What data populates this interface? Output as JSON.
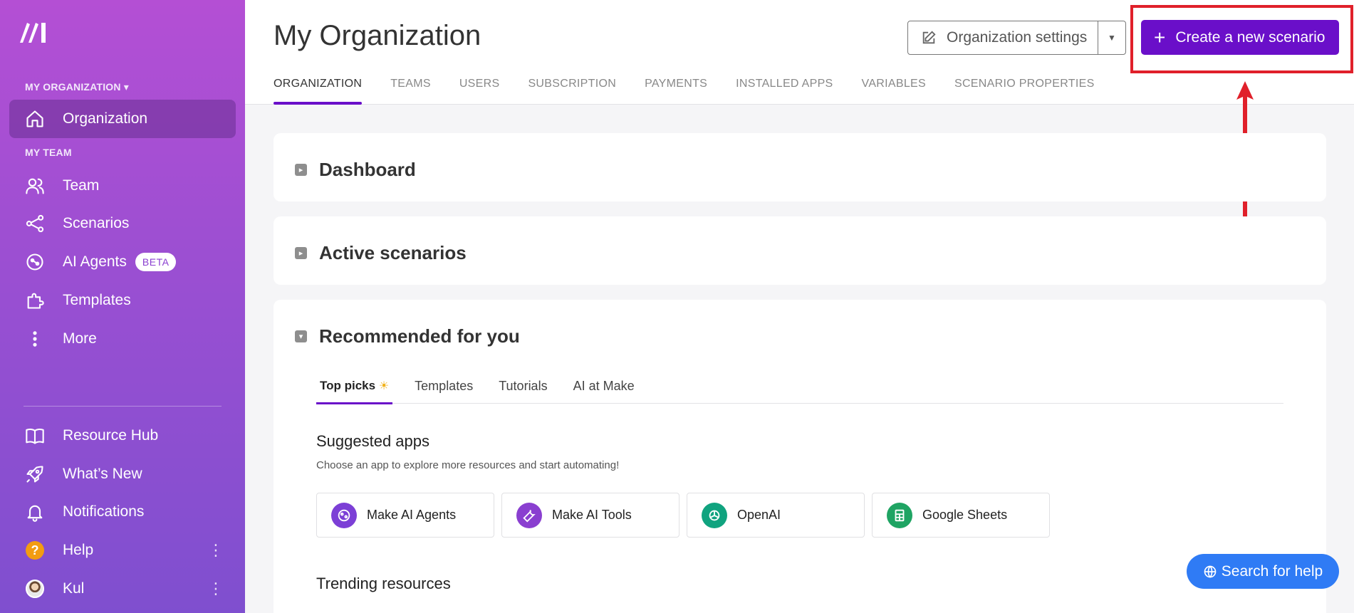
{
  "sidebar": {
    "section_org": "MY ORGANIZATION",
    "section_team": "MY TEAM",
    "items": [
      {
        "label": "Organization"
      },
      {
        "label": "Team"
      },
      {
        "label": "Scenarios"
      },
      {
        "label": "AI Agents",
        "badge": "BETA"
      },
      {
        "label": "Templates"
      },
      {
        "label": "More"
      }
    ],
    "bottom_items": [
      {
        "label": "Resource Hub"
      },
      {
        "label": "What’s New"
      },
      {
        "label": "Notifications"
      },
      {
        "label": "Help"
      },
      {
        "label": "Kul"
      }
    ]
  },
  "header": {
    "title": "My Organization",
    "org_settings_label": "Organization settings",
    "create_label": "Create a new scenario",
    "tabs": [
      "ORGANIZATION",
      "TEAMS",
      "USERS",
      "SUBSCRIPTION",
      "PAYMENTS",
      "INSTALLED APPS",
      "VARIABLES",
      "SCENARIO PROPERTIES"
    ]
  },
  "cards": {
    "dashboard": "Dashboard",
    "active_scenarios": "Active scenarios",
    "recommended": "Recommended for you"
  },
  "recommended": {
    "tabs": [
      "Top picks",
      "Templates",
      "Tutorials",
      "AI at Make"
    ],
    "suggested_title": "Suggested apps",
    "suggested_desc": "Choose an app to explore more resources and start automating!",
    "apps": [
      {
        "label": "Make AI Agents",
        "color": "#7c3fd6"
      },
      {
        "label": "Make AI Tools",
        "color": "#8a3fd0"
      },
      {
        "label": "OpenAI",
        "color": "#10a37f"
      },
      {
        "label": "Google Sheets",
        "color": "#1fa463"
      }
    ],
    "trending_title": "Trending resources"
  },
  "search_help_label": "Search for help",
  "colors": {
    "accent": "#6a0fc9",
    "highlight": "#e0202a",
    "help_button": "#2f7bf5"
  }
}
